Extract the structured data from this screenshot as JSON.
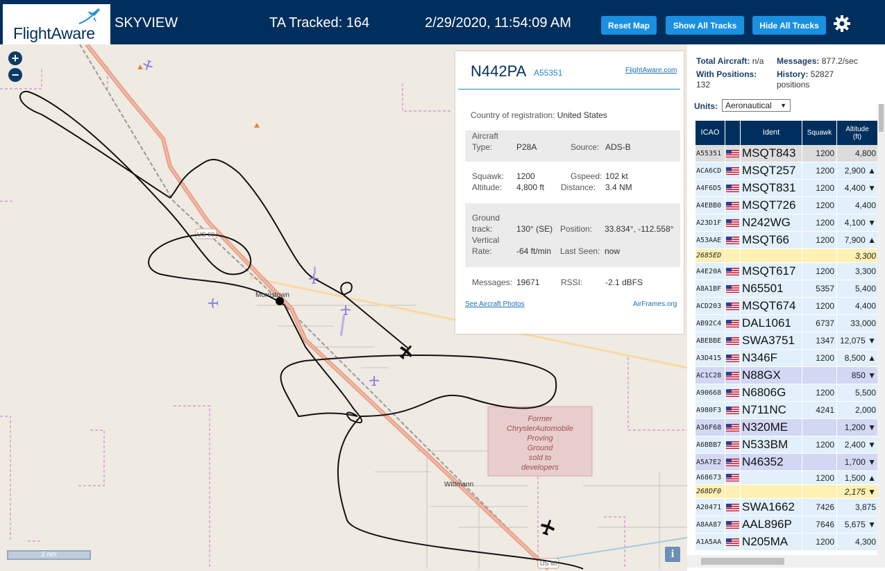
{
  "header": {
    "logo_text": "FlightAware",
    "app_title": "SKYVIEW",
    "ta_tracked": "TA Tracked: 164",
    "clock": "2/29/2020, 11:54:09 AM",
    "reset_label": "Reset Map",
    "show_all_label": "Show All Tracks",
    "hide_all_label": "Hide All Tracks",
    "settings_icon": "gear-icon"
  },
  "map": {
    "zoom_in": "+",
    "zoom_out": "−",
    "scale_label": "2 nm",
    "info_label": "i",
    "town_label": "Morristown",
    "town2_label": "Wittmann",
    "road_shield": "US 60",
    "provgrounds_lines": [
      "Former",
      "ChryslerAutomobile",
      "Proving",
      "Ground",
      "sold to",
      "developers"
    ]
  },
  "popup": {
    "registration": "N442PA",
    "hex": "A55351",
    "fa_link": "FlightAware.com",
    "country_label": "Country of registration:",
    "country_value": "United States",
    "aircraft_type_label_1": "Aircraft",
    "aircraft_type_label_2": "Type:",
    "aircraft_type": "P28A",
    "source_label": "Source:",
    "source": "ADS-B",
    "squawk_label": "Squawk:",
    "squawk": "1200",
    "gspeed_label": "Gspeed:",
    "gspeed": "102 kt",
    "altitude_label": "Altitude:",
    "altitude": "4,800 ft",
    "distance_label": "Distance:",
    "distance": "3.4 NM",
    "ground_track_label_1": "Ground",
    "ground_track_label_2": "track:",
    "ground_track": "130° (SE)",
    "position_label": "Position:",
    "position": "33.834°, -112.558°",
    "vrate_label_1": "Vertical",
    "vrate_label_2": "Rate:",
    "vrate": "-64 ft/min",
    "last_seen_label": "Last Seen:",
    "last_seen": "now",
    "messages_label": "Messages:",
    "messages": "19671",
    "rssi_label": "RSSI:",
    "rssi": "-2.1 dBFS",
    "photos_link": "See Aircraft Photos",
    "airframes_link": "AirFrames.org"
  },
  "stats": {
    "total_label": "Total Aircraft:",
    "total_value": "n/a",
    "messages_label": "Messages:",
    "messages_value": "877.2/sec",
    "positions_label": "With Positions:",
    "positions_value": "132",
    "history_label": "History:",
    "history_value": "52827",
    "history_unit": "positions",
    "units_label": "Units:",
    "units_value": "Aeronautical"
  },
  "table": {
    "headers": {
      "icao": "ICAO",
      "ident": "Ident",
      "squawk": "Squawk",
      "altitude_1": "Altitude",
      "altitude_2": "(ft)"
    },
    "rows": [
      {
        "icao": "A55351",
        "flag": true,
        "ident": "MSQT843",
        "squawk": "1200",
        "alt": "4,800",
        "cls": "selected"
      },
      {
        "icao": "ACA6CD",
        "flag": true,
        "ident": "MSQT257",
        "squawk": "1200",
        "alt": "2,900 ▲",
        "cls": "norm"
      },
      {
        "icao": "A4F6D5",
        "flag": true,
        "ident": "MSQT831",
        "squawk": "1200",
        "alt": "4,400 ▼",
        "cls": "norm"
      },
      {
        "icao": "A4EBB0",
        "flag": true,
        "ident": "MSQT726",
        "squawk": "1200",
        "alt": "4,400",
        "cls": "norm"
      },
      {
        "icao": "A23D1F",
        "flag": true,
        "ident": "N242WG",
        "squawk": "1200",
        "alt": "4,100 ▼",
        "cls": "norm"
      },
      {
        "icao": "A53AAE",
        "flag": true,
        "ident": "MSQT66",
        "squawk": "1200",
        "alt": "7,900 ▲",
        "cls": "norm"
      },
      {
        "icao": "2685ED",
        "flag": false,
        "ident": "",
        "squawk": "",
        "alt": "3,300",
        "cls": "tisb short"
      },
      {
        "icao": "A4E20A",
        "flag": true,
        "ident": "MSQT617",
        "squawk": "1200",
        "alt": "3,300",
        "cls": "norm"
      },
      {
        "icao": "A8A1BF",
        "flag": true,
        "ident": "N65501",
        "squawk": "5357",
        "alt": "5,400",
        "cls": "norm"
      },
      {
        "icao": "ACD203",
        "flag": true,
        "ident": "MSQT674",
        "squawk": "1200",
        "alt": "4,400",
        "cls": "norm"
      },
      {
        "icao": "AB92C4",
        "flag": true,
        "ident": "DAL1061",
        "squawk": "6737",
        "alt": "33,000",
        "cls": "norm"
      },
      {
        "icao": "ABEBBE",
        "flag": true,
        "ident": "SWA3751",
        "squawk": "1347",
        "alt": "12,075 ▼",
        "cls": "norm"
      },
      {
        "icao": "A3D415",
        "flag": true,
        "ident": "N346F",
        "squawk": "1200",
        "alt": "8,500 ▲",
        "cls": "norm"
      },
      {
        "icao": "AC1C28",
        "flag": true,
        "ident": "N88GX",
        "squawk": "",
        "alt": "850 ▼",
        "cls": "mlat"
      },
      {
        "icao": "A90668",
        "flag": true,
        "ident": "N6806G",
        "squawk": "1200",
        "alt": "5,500",
        "cls": "norm"
      },
      {
        "icao": "A980F3",
        "flag": true,
        "ident": "N711NC",
        "squawk": "4241",
        "alt": "2,000",
        "cls": "norm"
      },
      {
        "icao": "A36F68",
        "flag": true,
        "ident": "N320ME",
        "squawk": "",
        "alt": "1,200 ▼",
        "cls": "mlat"
      },
      {
        "icao": "A6BBB7",
        "flag": true,
        "ident": "N533BM",
        "squawk": "1200",
        "alt": "2,400 ▼",
        "cls": "norm"
      },
      {
        "icao": "A5A7E2",
        "flag": true,
        "ident": "N46352",
        "squawk": "",
        "alt": "1,700 ▼",
        "cls": "mlat"
      },
      {
        "icao": "A68673",
        "flag": true,
        "ident": "",
        "squawk": "1200",
        "alt": "1,500 ▲",
        "cls": "norm short"
      },
      {
        "icao": "268DF0",
        "flag": false,
        "ident": "",
        "squawk": "",
        "alt": "2,175 ▼",
        "cls": "tisb short"
      },
      {
        "icao": "A20471",
        "flag": true,
        "ident": "SWA1662",
        "squawk": "7426",
        "alt": "3,875",
        "cls": "norm"
      },
      {
        "icao": "A8AA87",
        "flag": true,
        "ident": "AAL896P",
        "squawk": "7646",
        "alt": "5,675 ▼",
        "cls": "norm"
      },
      {
        "icao": "A1A5AA",
        "flag": true,
        "ident": "N205MA",
        "squawk": "1200",
        "alt": "4,300",
        "cls": "norm"
      }
    ]
  },
  "colors": {
    "header_bg": "#002f5d",
    "button_blue": "#1a90e0",
    "map_bg": "#efeae2",
    "highway": "#e89a82",
    "track": "#111111",
    "mlat_row": "#d2d7f3",
    "tisb_row": "#fff1b3",
    "normal_row": "#e1f0fb"
  }
}
